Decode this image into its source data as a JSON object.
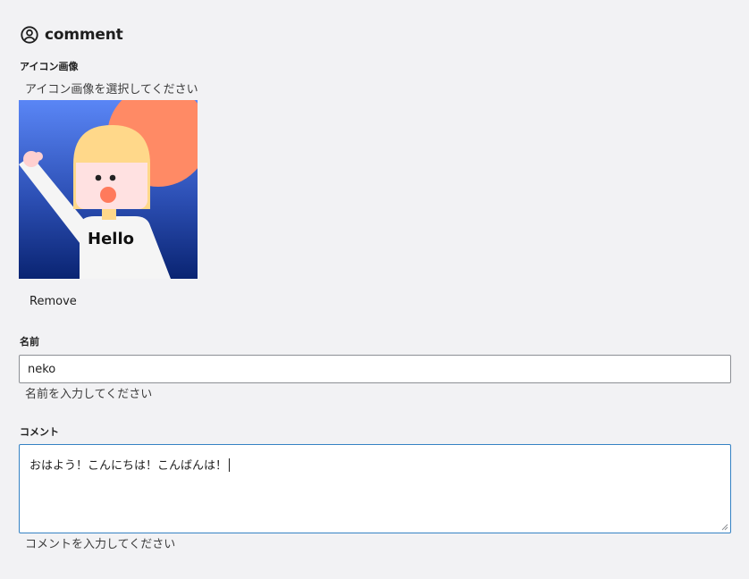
{
  "header": {
    "title": "comment",
    "icon": "user-circle-icon"
  },
  "icon_image": {
    "label": "アイコン画像",
    "select_text": "アイコン画像を選択してください",
    "preview_text": "Hello",
    "remove_label": "Remove"
  },
  "name": {
    "label": "名前",
    "value": "neko",
    "help": "名前を入力してください"
  },
  "comment": {
    "label": "コメント",
    "value": "おはよう！こんにちは！こんばんは！",
    "help": "コメントを入力してください"
  },
  "colors": {
    "background": "#f2f2f4",
    "focus_border": "#3582c4",
    "input_border": "#8c8f94"
  }
}
